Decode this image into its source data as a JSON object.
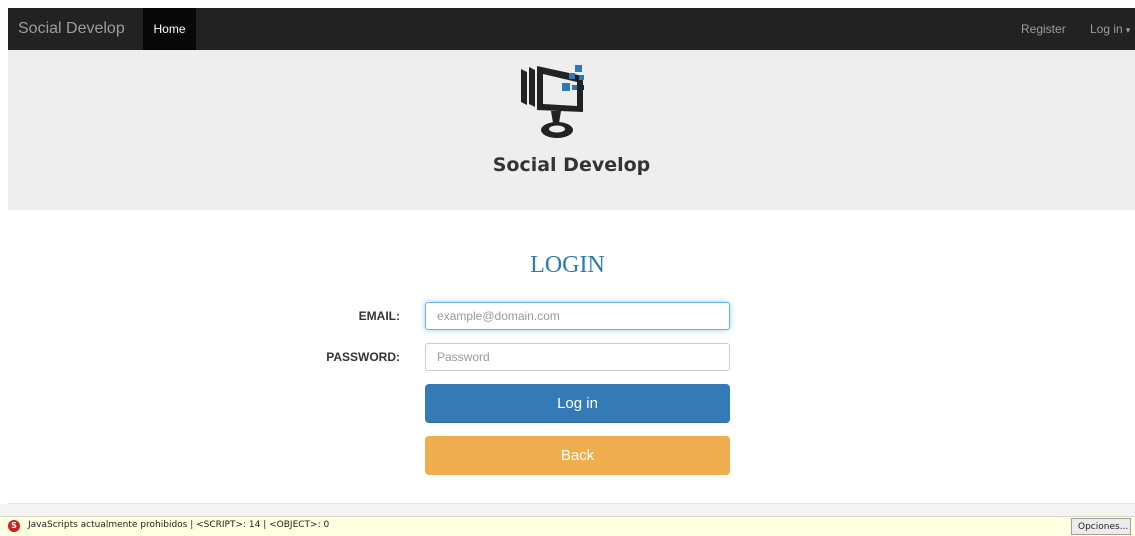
{
  "navbar": {
    "brand": "Social Develop",
    "home": "Home",
    "register": "Register",
    "login_menu": "Log in"
  },
  "hero": {
    "logo_text": "Social Develop"
  },
  "login": {
    "title": "LOGIN",
    "email_label": "EMAIL:",
    "email_placeholder": "example@domain.com",
    "password_label": "PASSWORD:",
    "password_placeholder": "Password",
    "login_button": "Log in",
    "back_button": "Back"
  },
  "statusbar": {
    "text": "JavaScripts actualmente prohibidos | <SCRIPT>: 14 | <OBJECT>: 0",
    "options_button": "Opciones..."
  },
  "colors": {
    "navbar_bg": "#222222",
    "hero_bg": "#eeeeee",
    "title": "#2a7ab0",
    "primary": "#337ab7",
    "warning": "#f0ad4e"
  }
}
